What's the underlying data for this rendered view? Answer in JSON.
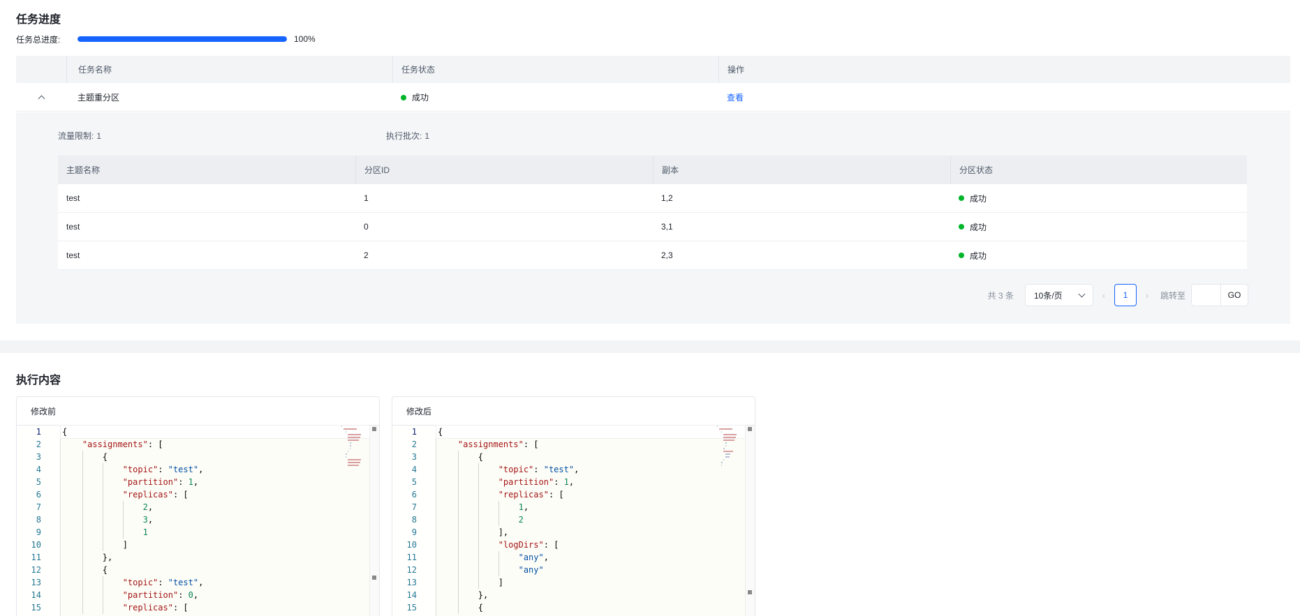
{
  "progress_section": {
    "title": "任务进度",
    "progress_label": "任务总进度:",
    "progress_percent_text": "100%",
    "progress_value": 1.0
  },
  "task_table": {
    "headers": [
      "任务名称",
      "任务状态",
      "操作"
    ],
    "rows": [
      {
        "name": "主题重分区",
        "status": "成功",
        "action": "查看"
      }
    ]
  },
  "expanded": {
    "rate_limit_label": "流量限制:",
    "rate_limit_value": "1",
    "batch_label": "执行批次:",
    "batch_value": "1",
    "headers": [
      "主题名称",
      "分区ID",
      "副本",
      "分区状态"
    ],
    "rows": [
      {
        "topic": "test",
        "partition": "1",
        "replicas": "1,2",
        "status": "成功"
      },
      {
        "topic": "test",
        "partition": "0",
        "replicas": "3,1",
        "status": "成功"
      },
      {
        "topic": "test",
        "partition": "2",
        "replicas": "2,3",
        "status": "成功"
      }
    ]
  },
  "pagination": {
    "total": "共 3 条",
    "page_size": "10条/页",
    "current_page": "1",
    "jump_label": "跳转至",
    "go_label": "GO"
  },
  "exec_section": {
    "title": "执行内容",
    "before_title": "修改前",
    "after_title": "修改后"
  },
  "before_code": [
    [
      [
        "p",
        "{"
      ]
    ],
    [
      [
        "i",
        1
      ],
      [
        "k",
        "\"assignments\""
      ],
      [
        "p",
        ": ["
      ]
    ],
    [
      [
        "i",
        2
      ],
      [
        "p",
        "{"
      ]
    ],
    [
      [
        "i",
        3
      ],
      [
        "k",
        "\"topic\""
      ],
      [
        "p",
        ": "
      ],
      [
        "s",
        "\"test\""
      ],
      [
        "p",
        ","
      ]
    ],
    [
      [
        "i",
        3
      ],
      [
        "k",
        "\"partition\""
      ],
      [
        "p",
        ": "
      ],
      [
        "n",
        "1"
      ],
      [
        "p",
        ","
      ]
    ],
    [
      [
        "i",
        3
      ],
      [
        "k",
        "\"replicas\""
      ],
      [
        "p",
        ": ["
      ]
    ],
    [
      [
        "i",
        4
      ],
      [
        "n",
        "2"
      ],
      [
        "p",
        ","
      ]
    ],
    [
      [
        "i",
        4
      ],
      [
        "n",
        "3"
      ],
      [
        "p",
        ","
      ]
    ],
    [
      [
        "i",
        4
      ],
      [
        "n",
        "1"
      ]
    ],
    [
      [
        "i",
        3
      ],
      [
        "p",
        "]"
      ]
    ],
    [
      [
        "i",
        2
      ],
      [
        "p",
        "},"
      ]
    ],
    [
      [
        "i",
        2
      ],
      [
        "p",
        "{"
      ]
    ],
    [
      [
        "i",
        3
      ],
      [
        "k",
        "\"topic\""
      ],
      [
        "p",
        ": "
      ],
      [
        "s",
        "\"test\""
      ],
      [
        "p",
        ","
      ]
    ],
    [
      [
        "i",
        3
      ],
      [
        "k",
        "\"partition\""
      ],
      [
        "p",
        ": "
      ],
      [
        "n",
        "0"
      ],
      [
        "p",
        ","
      ]
    ],
    [
      [
        "i",
        3
      ],
      [
        "k",
        "\"replicas\""
      ],
      [
        "p",
        ": ["
      ]
    ]
  ],
  "after_code": [
    [
      [
        "p",
        "{"
      ]
    ],
    [
      [
        "i",
        1
      ],
      [
        "k",
        "\"assignments\""
      ],
      [
        "p",
        ": ["
      ]
    ],
    [
      [
        "i",
        2
      ],
      [
        "p",
        "{"
      ]
    ],
    [
      [
        "i",
        3
      ],
      [
        "k",
        "\"topic\""
      ],
      [
        "p",
        ": "
      ],
      [
        "s",
        "\"test\""
      ],
      [
        "p",
        ","
      ]
    ],
    [
      [
        "i",
        3
      ],
      [
        "k",
        "\"partition\""
      ],
      [
        "p",
        ": "
      ],
      [
        "n",
        "1"
      ],
      [
        "p",
        ","
      ]
    ],
    [
      [
        "i",
        3
      ],
      [
        "k",
        "\"replicas\""
      ],
      [
        "p",
        ": ["
      ]
    ],
    [
      [
        "i",
        4
      ],
      [
        "n",
        "1"
      ],
      [
        "p",
        ","
      ]
    ],
    [
      [
        "i",
        4
      ],
      [
        "n",
        "2"
      ]
    ],
    [
      [
        "i",
        3
      ],
      [
        "p",
        "],"
      ]
    ],
    [
      [
        "i",
        3
      ],
      [
        "k",
        "\"logDirs\""
      ],
      [
        "p",
        ": ["
      ]
    ],
    [
      [
        "i",
        4
      ],
      [
        "s",
        "\"any\""
      ],
      [
        "p",
        ","
      ]
    ],
    [
      [
        "i",
        4
      ],
      [
        "s",
        "\"any\""
      ]
    ],
    [
      [
        "i",
        3
      ],
      [
        "p",
        "]"
      ]
    ],
    [
      [
        "i",
        2
      ],
      [
        "p",
        "},"
      ]
    ],
    [
      [
        "i",
        2
      ],
      [
        "p",
        "{"
      ]
    ]
  ],
  "colors": {
    "accent": "#1664ff",
    "success": "#00b42a",
    "json_key": "#a31515",
    "json_string": "#0451a5",
    "json_number": "#098658",
    "line_number": "#237893"
  },
  "icons": {
    "expand": "chevron-up-icon",
    "status": "status-dot-icon",
    "page_size_caret": "chevron-down-icon",
    "prev": "chevron-left-icon",
    "next": "chevron-right-icon"
  }
}
